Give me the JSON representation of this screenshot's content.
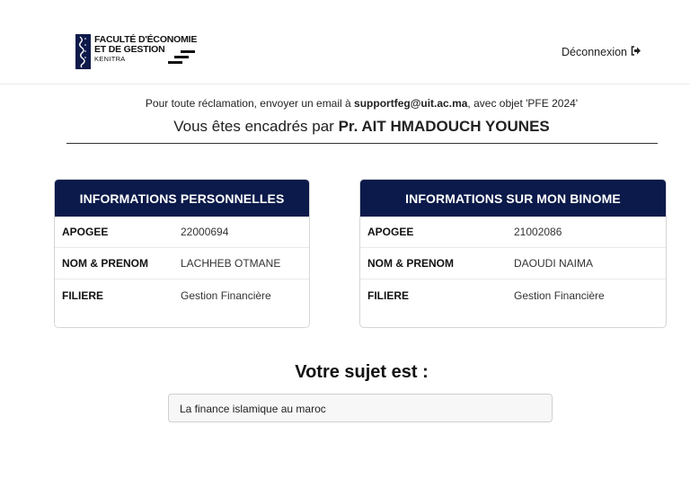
{
  "header": {
    "logo": {
      "line1": "FACULTÉ D'ÉCONOMIE",
      "line2": "ET DE GESTION",
      "line3": "KENITRA"
    },
    "logout_label": "Déconnexion",
    "logout_icon": "sign-out-icon"
  },
  "notice": {
    "prefix": "Pour toute réclamation, envoyer un email à ",
    "email": "supportfeg@uit.ac.ma",
    "suffix": ", avec objet 'PFE 2024'"
  },
  "supervisor": {
    "prefix": "Vous êtes encadrés par ",
    "name": "Pr. AIT HMADOUCH YOUNES"
  },
  "personal_info": {
    "title": "INFORMATIONS PERSONNELLES",
    "rows": [
      {
        "label": "APOGEE",
        "value": "22000694"
      },
      {
        "label": "NOM & PRENOM",
        "value": "LACHHEB OTMANE"
      },
      {
        "label": "FILIERE",
        "value": "Gestion Financière"
      }
    ]
  },
  "binome_info": {
    "title": "INFORMATIONS SUR MON BINOME",
    "rows": [
      {
        "label": "APOGEE",
        "value": "21002086"
      },
      {
        "label": "NOM & PRENOM",
        "value": "DAOUDI NAIMA"
      },
      {
        "label": "FILIERE",
        "value": "Gestion Financière"
      }
    ]
  },
  "subject": {
    "title": "Votre sujet est :",
    "value": "La finance islamique au maroc"
  },
  "colors": {
    "header_bg": "#0b1a4a",
    "logo_mark": "#0d1a4a"
  }
}
